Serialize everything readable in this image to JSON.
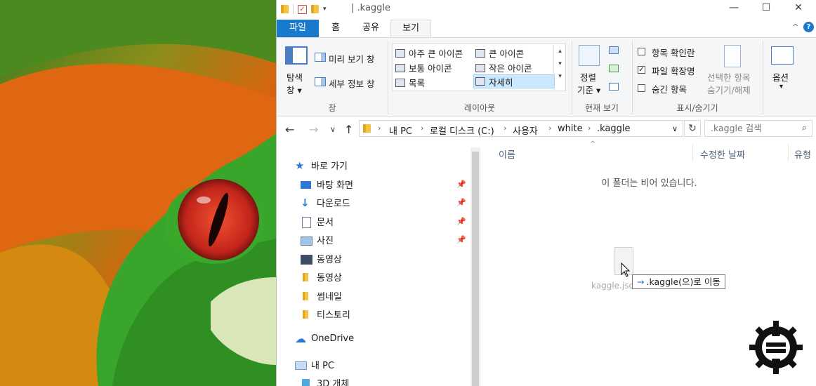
{
  "titlebar": {
    "title": "| .kaggle",
    "qat_dropdown": "▾",
    "minimize": "—",
    "maximize": "☐",
    "close": "✕"
  },
  "tabs": [
    {
      "label": "파일"
    },
    {
      "label": "홈"
    },
    {
      "label": "공유"
    },
    {
      "label": "보기"
    }
  ],
  "ribbon_collapse": "^",
  "help": "?",
  "ribbon": {
    "panes": {
      "nav_pane_label_1": "탐색",
      "nav_pane_label_2": "창 ▾",
      "preview_pane": "미리 보기 창",
      "details_pane": "세부 정보 창",
      "group_label": "창"
    },
    "layout": {
      "items": [
        "아주 큰 아이콘",
        "큰 아이콘",
        "보통 아이콘",
        "작은 아이콘",
        "목록",
        "자세히"
      ],
      "selected": "자세히",
      "scroll_up": "▴",
      "scroll_down": "▾",
      "scroll_more": "▾",
      "group_label": "레이아웃"
    },
    "current_view": {
      "sort_label_1": "정렬",
      "sort_label_2": "기준 ▾",
      "group_label": "현재 보기"
    },
    "show_hide": {
      "item_checkboxes": {
        "label": "항목 확인란",
        "checked": false
      },
      "file_extensions": {
        "label": "파일 확장명",
        "checked": true
      },
      "hidden_items": {
        "label": "숨긴 항목",
        "checked": false
      },
      "hide_selected_1": "선택한 항목",
      "hide_selected_2": "숨기기/해제",
      "group_label": "표시/숨기기"
    },
    "options": {
      "label": "옵션",
      "arrow": "▾"
    }
  },
  "address": {
    "back": "←",
    "forward": "→",
    "recent": "∨",
    "up": "↑",
    "crumbs": [
      "내 PC",
      "로컬 디스크 (C:)",
      "사용자",
      "white",
      ".kaggle"
    ],
    "sep": "›",
    "dropdown": "∨",
    "refresh": "↻"
  },
  "search": {
    "placeholder": ".kaggle 검색",
    "icon": "⌕"
  },
  "navpane": {
    "quick_access": "바로 가기",
    "pinned": [
      {
        "label": "바탕 화면",
        "icon": "desktop-icon"
      },
      {
        "label": "다운로드",
        "icon": "download-icon"
      },
      {
        "label": "문서",
        "icon": "document-icon"
      },
      {
        "label": "사진",
        "icon": "pictures-icon"
      }
    ],
    "recent": [
      {
        "label": "동영상",
        "icon": "video-icon"
      },
      {
        "label": "동영상",
        "icon": "folder-icon"
      },
      {
        "label": "썸네일",
        "icon": "folder-icon"
      },
      {
        "label": "티스토리",
        "icon": "folder-icon"
      }
    ],
    "onedrive": "OneDrive",
    "this_pc": "내 PC",
    "objects_3d": "3D 개체",
    "pin_glyph": "📌"
  },
  "columns": {
    "name": "이름",
    "modified": "수정한 날짜",
    "type": "유형"
  },
  "sort_caret": "^",
  "empty_message": "이 폴더는 비어 있습니다.",
  "drag": {
    "file_label": "kaggle.json",
    "tooltip_arrow": "→",
    "tooltip": ".kaggle(으)로 이동"
  },
  "colors": {
    "accent": "#1979ca",
    "ribbon_bg": "#f5f6f7",
    "selected_bg": "#cce8ff",
    "folder": "#f5c342"
  }
}
